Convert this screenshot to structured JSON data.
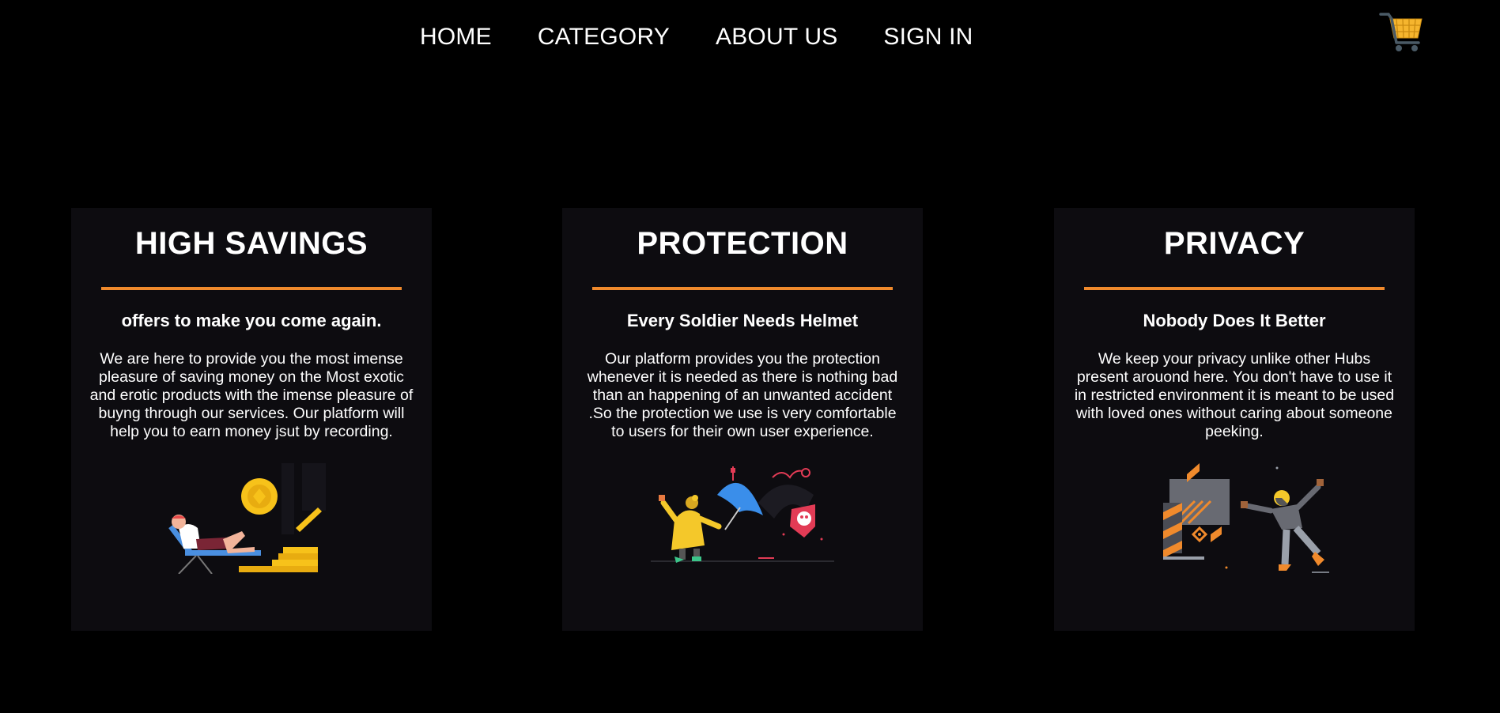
{
  "nav": {
    "items": [
      "HOME",
      "CATEGORY",
      "ABOUT US",
      "SIGN IN"
    ]
  },
  "cart": {
    "icon": "shopping-cart-icon"
  },
  "colors": {
    "background": "#000000",
    "card": "#0d0c10",
    "accent": "#f08a2c",
    "text": "#ffffff"
  },
  "cards": [
    {
      "title": "HIGH SAVINGS",
      "subtitle": "offers to make you come again.",
      "description": "We are here to provide you the most imense pleasure of saving money on the Most exotic and erotic products with the imense pleasure of buyng through our services. Our platform will help you to earn money jsut by recording.",
      "illustration": "relaxing-with-coins-illustration"
    },
    {
      "title": "PROTECTION",
      "subtitle": "Every Soldier Needs Helmet",
      "description": "Our platform provides you the protection whenever it is needed as there is nothing bad than an happening of an unwanted accident .So the protection we use is very comfortable to users for their own user experience.",
      "illustration": "umbrella-shield-illustration"
    },
    {
      "title": "PRIVACY",
      "subtitle": "Nobody Does It Better",
      "description": "We keep your privacy unlike other Hubs present arouond here. You don't have to use it in restricted environment it is meant to be used with loved ones without caring about someone peeking.",
      "illustration": "privacy-screen-illustration"
    }
  ]
}
